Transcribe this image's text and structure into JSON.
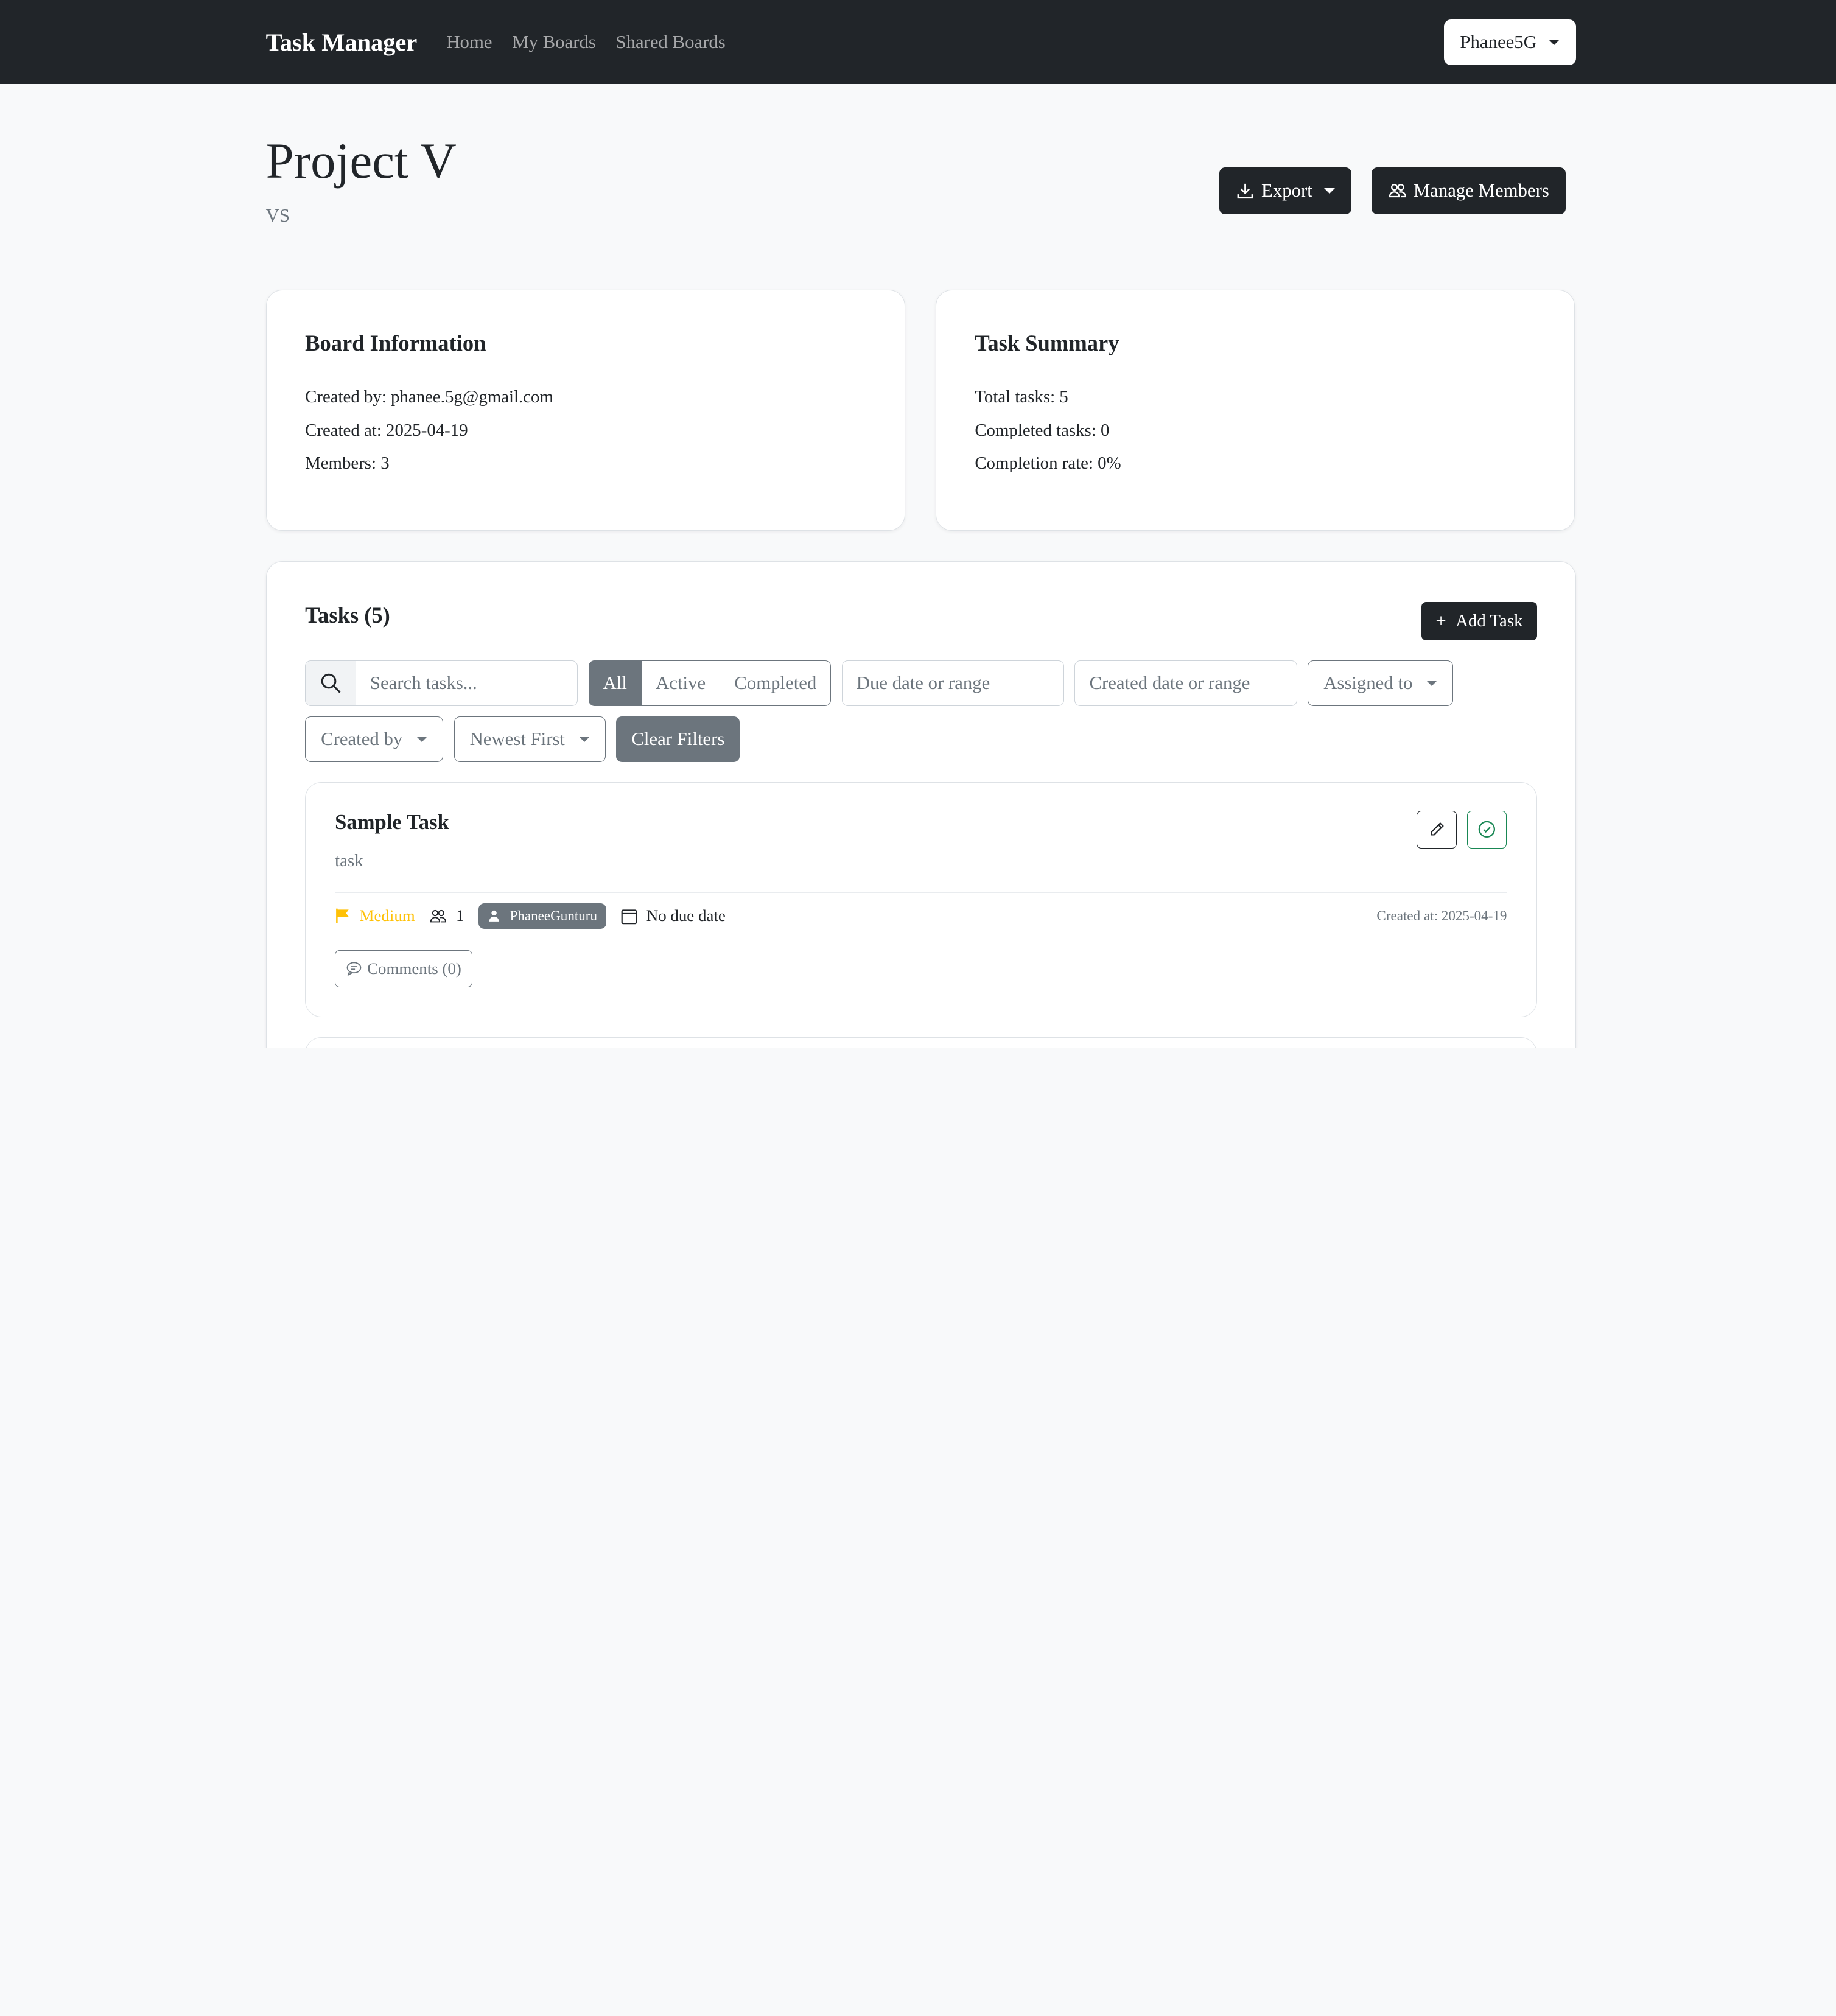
{
  "navbar": {
    "brand": "Task Manager",
    "links": [
      "Home",
      "My Boards",
      "Shared Boards"
    ],
    "user": "Phanee5G"
  },
  "header": {
    "title": "Project V",
    "subtitle": "VS",
    "export_label": "Export",
    "manage_members_label": "Manage Members"
  },
  "board_info": {
    "title": "Board Information",
    "created_by": "Created by: phanee.5g@gmail.com",
    "created_at": "Created at: 2025-04-19",
    "members": "Members: 3"
  },
  "task_summary": {
    "title": "Task Summary",
    "total": "Total tasks: 5",
    "completed": "Completed tasks: 0",
    "rate": "Completion rate: 0%"
  },
  "tasks": {
    "title": "Tasks (5)",
    "add_label": "Add Task",
    "search_placeholder": "Search tasks...",
    "status_tabs": [
      "All",
      "Active",
      "Completed"
    ],
    "active_tab": "All",
    "due_date_placeholder": "Due date or range",
    "created_date_placeholder": "Created date or range",
    "assigned_to": "Assigned to",
    "created_by": "Created by",
    "sort": "Newest First",
    "clear_filters": "Clear Filters",
    "items": [
      {
        "name": "Sample Task",
        "description": "task",
        "priority": "Medium",
        "member_count": "1",
        "assignee": "PhaneeGunturu",
        "due": "No due date",
        "created_at": "Created at: 2025-04-19",
        "comments": "Comments (0)"
      }
    ]
  },
  "colors": {
    "navbar": "#212529",
    "priority_medium": "#ffc107",
    "complete_green": "#198754",
    "secondary": "#6c757d"
  }
}
